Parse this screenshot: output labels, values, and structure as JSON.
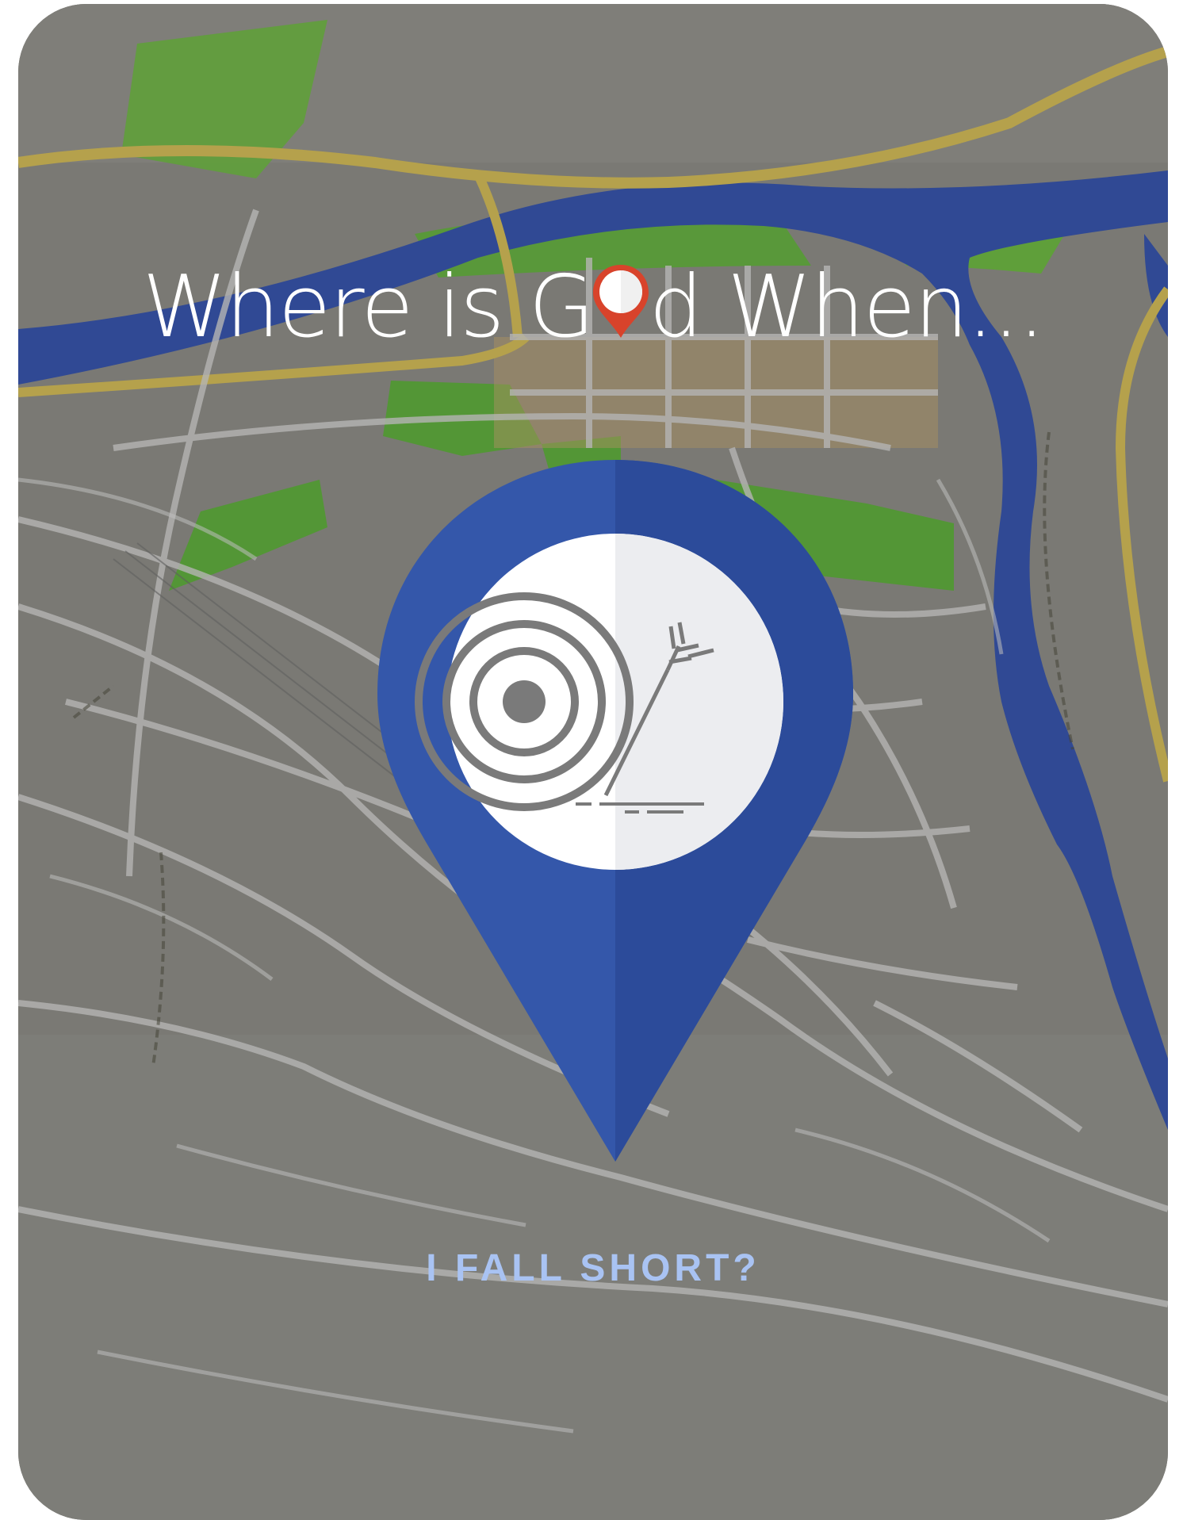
{
  "title": {
    "before_o": "Where is G",
    "after_o": "d When..."
  },
  "subtitle": "I FALL SHORT?",
  "icons": {
    "title_o": "map-marker-pin-icon",
    "main": "location-pin-icon",
    "inner": "target-with-arrow-icon"
  },
  "colors": {
    "map_base": "#7e7d78",
    "roads": "#c9c9c9",
    "river": "#1f3fa0",
    "parks": "#5cae2e",
    "major_roads": "#c9b045",
    "pin_blue_light": "#3457aa",
    "pin_blue_dark": "#2c4b9a",
    "marker_red": "#d8432b",
    "subtitle": "#a9c3f3",
    "target_gray": "#7a7a7a"
  }
}
